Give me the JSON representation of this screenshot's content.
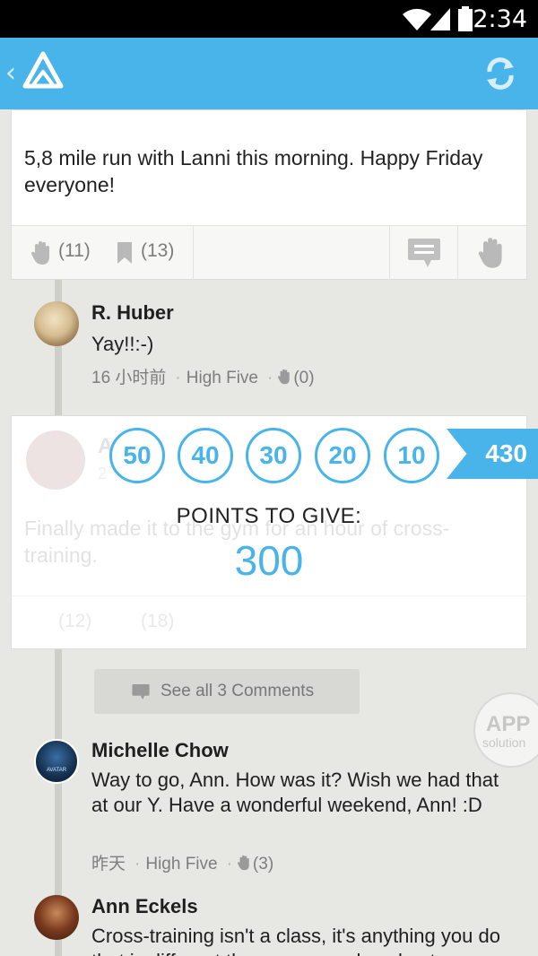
{
  "status_bar": {
    "time": "2:34"
  },
  "app_bar": {
    "back_icon": "chevron-left",
    "logo_icon": "triangle-logo",
    "refresh_icon": "sync-icon"
  },
  "post_top": {
    "text": "5,8 mile run with Lanni this morning. Happy Friday everyone!",
    "high_five_count": "(11)",
    "bookmark_count": "(13)"
  },
  "comment_huber": {
    "name": "R. Huber",
    "text": "Yay!!:-)",
    "time": "16 小时前",
    "high_five_label": "High Five",
    "high_five_count": "(0)"
  },
  "post_faded": {
    "author_partial": "A",
    "author_meta_partial": "2",
    "text": "Finally made it to the gym for an hour of cross-training.",
    "high_five_count": "(12)",
    "bookmark_count": "(18)"
  },
  "points_overlay": {
    "options": [
      "50",
      "40",
      "30",
      "20",
      "10"
    ],
    "total": "430",
    "label": "POINTS TO GIVE:",
    "value": "300"
  },
  "see_all": {
    "label": "See all 3 Comments"
  },
  "comment_chow": {
    "name": "Michelle Chow",
    "text": "Way to go, Ann.  How was it?  Wish we had that at our Y.  Have a wonderful weekend, Ann!  :D",
    "time": "昨天",
    "high_five_label": "High Five",
    "high_five_count": "(3)",
    "avatar_text": "AVATAR"
  },
  "comment_eckels": {
    "name": "Ann Eckels",
    "text": "Cross-training isn't a class, it's anything you do that is different than your usual workout."
  },
  "watermark": {
    "line1": "APP",
    "line2": "solution"
  },
  "colors": {
    "accent": "#49b4e9",
    "background": "#e7e7e3"
  }
}
